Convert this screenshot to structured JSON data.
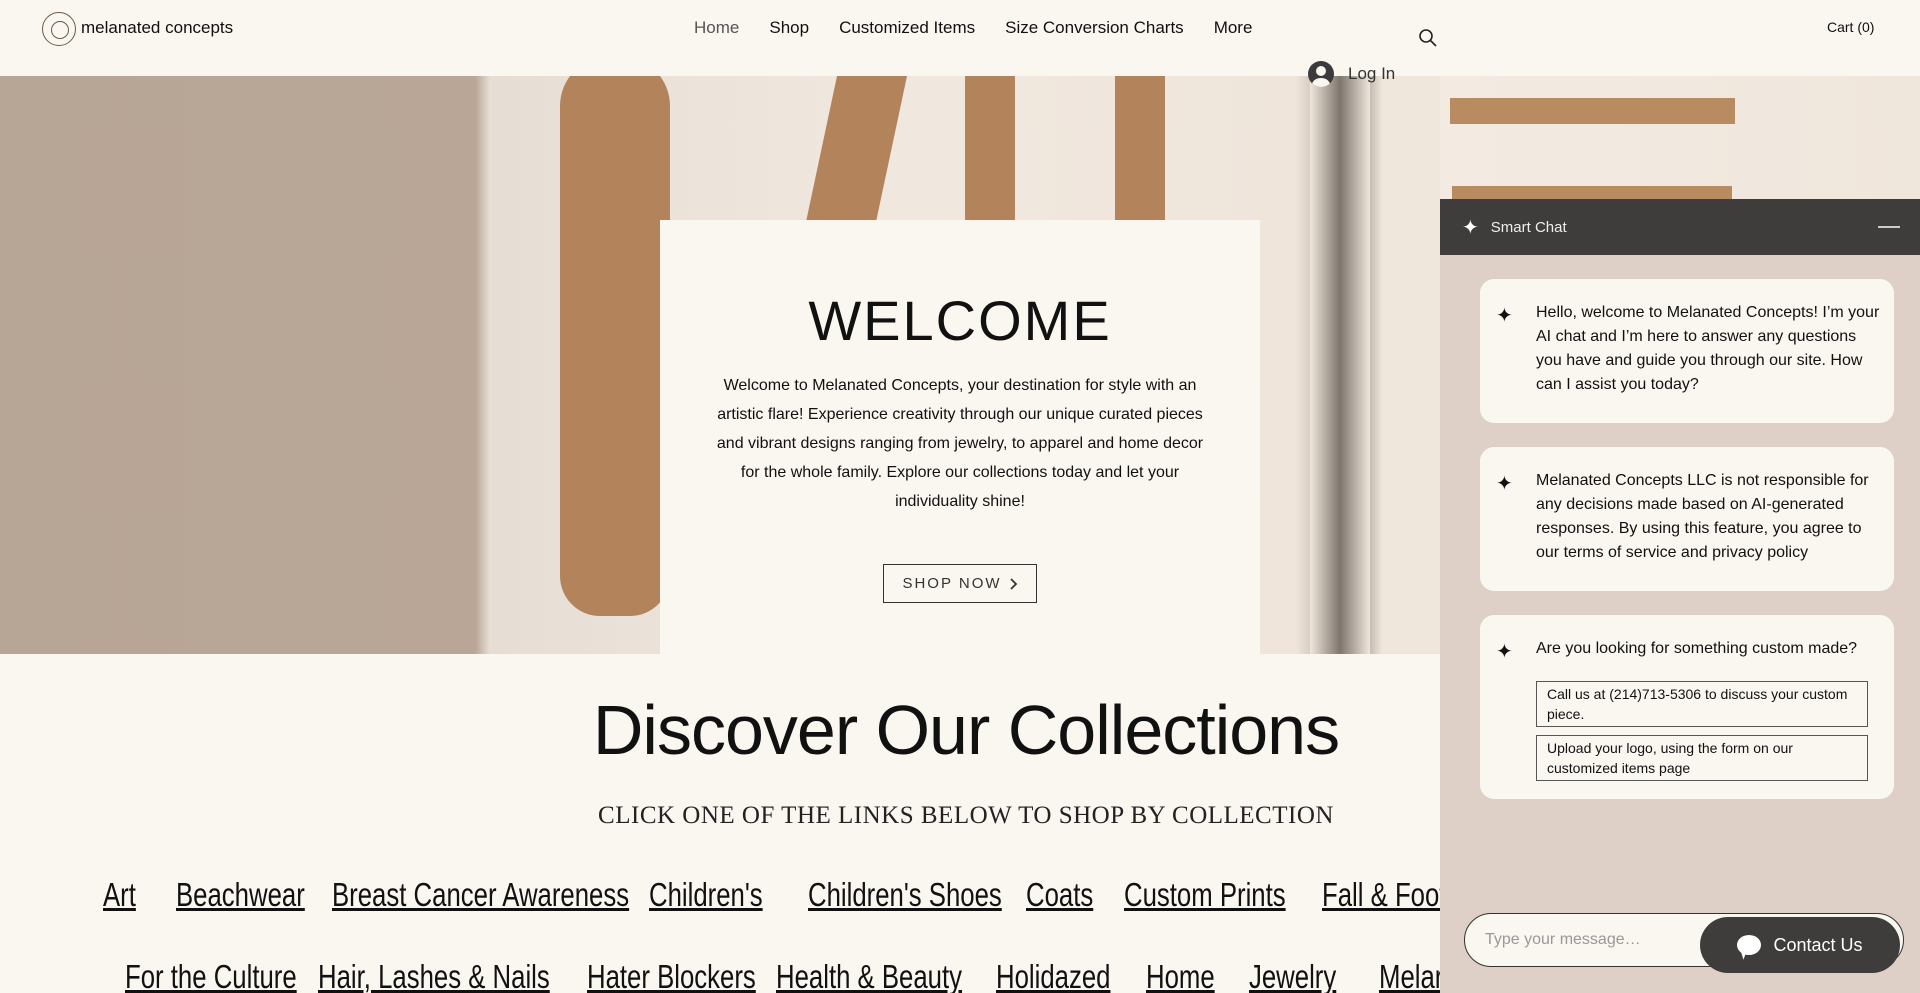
{
  "header": {
    "brand": "melanated concepts",
    "nav": [
      "Home",
      "Shop",
      "Customized Items",
      "Size Conversion Charts",
      "More"
    ],
    "cart": "Cart (0)",
    "login": "Log In"
  },
  "hero": {
    "title": "WELCOME",
    "text": "Welcome to Melanated Concepts, your destination for style with an artistic flare! Experience creativity through our unique curated pieces and vibrant designs ranging from jewelry, to apparel and home decor for the whole family.  Explore our collections today and let your individuality shine!",
    "button": "SHOP NOW"
  },
  "collections": {
    "title": "Discover Our Collections",
    "subtitle": "CLICK ONE OF THE LINKS BELOW TO SHOP BY COLLECTION",
    "row1": [
      "Art",
      "Beachwear",
      "Breast Cancer Awareness",
      "Children's ",
      "Children's Shoes",
      "Coats",
      "Custom Prints",
      "Fall & Foot"
    ],
    "row2": [
      "For the Culture",
      "Hair, Lashes & Nails",
      "Hater Blockers",
      "Health & Beauty",
      "Holidazed",
      "Home",
      "Jewelry",
      "Melar"
    ]
  },
  "chat": {
    "title": "Smart Chat",
    "messages": [
      "Hello, welcome to Melanated Concepts! I’m your AI chat and I’m here to answer any questions you have and guide you through our site. How can I assist you today?",
      "Melanated Concepts LLC is not responsible for any decisions made based on AI-generated responses. By using this feature, you agree to our terms of service and privacy policy",
      "Are you looking for something custom made?"
    ],
    "options": [
      "Call us at (214)713-5306 to discuss your custom piece.",
      "Upload your logo, using the form on our customized items page"
    ],
    "placeholder": "Type your message…",
    "contact": "Contact Us"
  },
  "colors": {
    "accent_copper": "#b3845b",
    "chat_header": "#3e3d3b",
    "background": "#faf6f0"
  }
}
